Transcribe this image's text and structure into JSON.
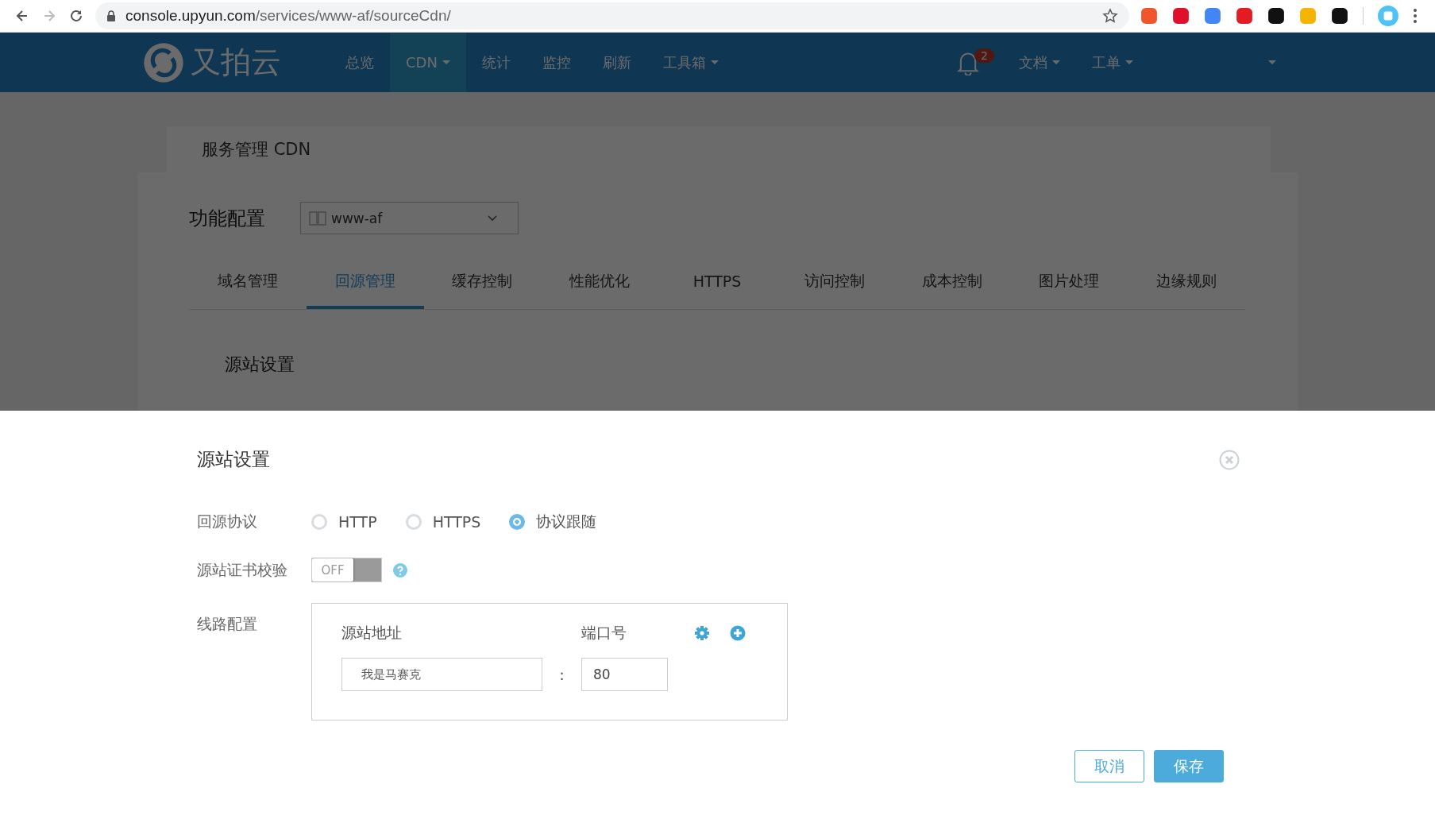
{
  "browser": {
    "url_host": "console.upyun.com",
    "url_path": "/services/www-af/sourceCdn/"
  },
  "nav": {
    "logo": "又拍云",
    "items": [
      {
        "label": "总览",
        "selected": false,
        "dropdown": false
      },
      {
        "label": "CDN",
        "selected": true,
        "dropdown": true
      },
      {
        "label": "统计",
        "selected": false,
        "dropdown": false
      },
      {
        "label": "监控",
        "selected": false,
        "dropdown": false
      },
      {
        "label": "刷新",
        "selected": false,
        "dropdown": false
      },
      {
        "label": "工具箱",
        "selected": false,
        "dropdown": true
      }
    ],
    "notification_count": "2",
    "right_menus": [
      {
        "label": "文档"
      },
      {
        "label": "工单"
      }
    ]
  },
  "page": {
    "breadcrumb": "服务管理 CDN",
    "config_label": "功能配置",
    "domain_select": "www-af",
    "tabs": [
      {
        "label": "域名管理",
        "selected": false
      },
      {
        "label": "回源管理",
        "selected": true
      },
      {
        "label": "缓存控制",
        "selected": false
      },
      {
        "label": "性能优化",
        "selected": false
      },
      {
        "label": "HTTPS",
        "selected": false
      },
      {
        "label": "访问控制",
        "selected": false
      },
      {
        "label": "成本控制",
        "selected": false
      },
      {
        "label": "图片处理",
        "selected": false
      },
      {
        "label": "边缘规则",
        "selected": false
      }
    ],
    "section_title": "源站设置"
  },
  "modal": {
    "title": "源站设置",
    "protocol": {
      "label": "回源协议",
      "options": [
        {
          "label": "HTTP",
          "selected": false
        },
        {
          "label": "HTTPS",
          "selected": false
        },
        {
          "label": "协议跟随",
          "selected": true
        }
      ]
    },
    "cert_check": {
      "label": "源站证书校验",
      "on": false,
      "switch_text": "OFF"
    },
    "route": {
      "label": "线路配置",
      "address_header": "源站地址",
      "port_header": "端口号",
      "separator": ":",
      "rows": [
        {
          "address": "我是马赛克",
          "port": "80"
        }
      ]
    },
    "buttons": [
      {
        "label": "取消",
        "kind": "secondary"
      },
      {
        "label": "保存",
        "kind": "primary"
      }
    ]
  }
}
